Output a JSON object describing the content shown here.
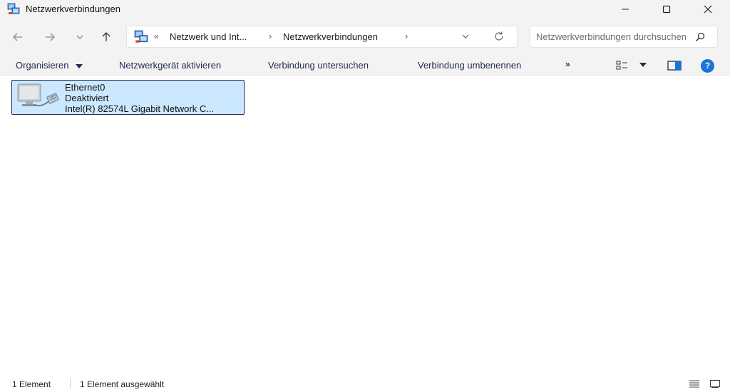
{
  "window": {
    "title": "Netzwerkverbindungen"
  },
  "navigation": {
    "breadcrumb_overflow": "«",
    "breadcrumbs": [
      {
        "label": "Netzwerk und Int..."
      },
      {
        "label": "Netzwerkverbindungen"
      }
    ],
    "separator": "›",
    "search_placeholder": "Netzwerkverbindungen durchsuchen"
  },
  "commandbar": {
    "organize_label": "Organisieren",
    "activate_label": "Netzwerkgerät aktivieren",
    "diagnose_label": "Verbindung untersuchen",
    "rename_label": "Verbindung umbenennen",
    "more_label": "»",
    "help_label": "?"
  },
  "items": [
    {
      "name": "Ethernet0",
      "status": "Deaktiviert",
      "adapter": "Intel(R) 82574L Gigabit Network C..."
    }
  ],
  "statusbar": {
    "count": "1 Element",
    "selected": "1 Element ausgewählt"
  },
  "colors": {
    "chrome_bg": "#f3f3f3",
    "selection_bg": "#cce8ff",
    "selection_border": "#1f2a55",
    "help_blue": "#1a73d9",
    "command_text": "#1f2a55"
  }
}
